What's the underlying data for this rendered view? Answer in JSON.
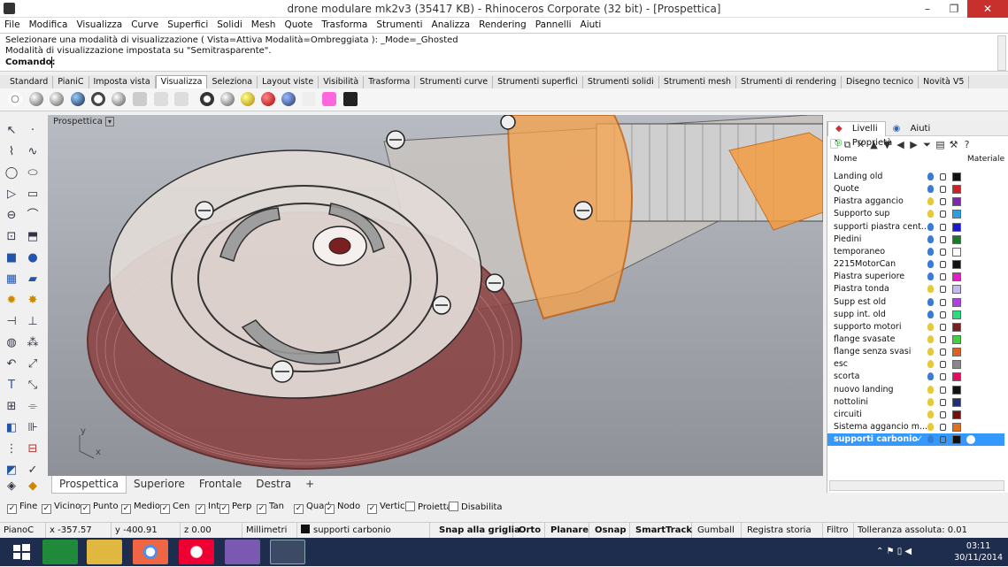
{
  "window": {
    "title": "drone modulare mk2v3 (35417 KB) - Rhinoceros Corporate (32 bit) - [Prospettica]"
  },
  "menu": [
    "File",
    "Modifica",
    "Visualizza",
    "Curve",
    "Superfici",
    "Solidi",
    "Mesh",
    "Quote",
    "Trasforma",
    "Strumenti",
    "Analizza",
    "Rendering",
    "Pannelli",
    "Aiuti"
  ],
  "command": {
    "history1": "Selezionare una modalità di visualizzazione ( Vista=Attiva  Modalità=Ombreggiata ): _Mode=_Ghosted",
    "history2": "Modalità di visualizzazione impostata su \"Semitrasparente\".",
    "prompt": "Comando:"
  },
  "toolbar_tabs": [
    "Standard",
    "PianiC",
    "Imposta vista",
    "Visualizza",
    "Seleziona",
    "Layout viste",
    "Visibilità",
    "Trasforma",
    "Strumenti curve",
    "Strumenti superfici",
    "Strumenti solidi",
    "Strumenti mesh",
    "Strumenti di rendering",
    "Disegno tecnico",
    "Novità V5"
  ],
  "active_toolbar_tab": "Visualizza",
  "viewport": {
    "label": "Prospettica",
    "axis_y": "y",
    "axis_x": "x"
  },
  "view_tabs": [
    "Prospettica",
    "Superiore",
    "Frontale",
    "Destra",
    "+"
  ],
  "panel": {
    "tabs": [
      "Livelli",
      "Aiuti",
      "Proprietà"
    ],
    "col_name": "Nome",
    "col_material": "Materiale",
    "layers": [
      {
        "name": "Landing old",
        "bulb": "#3a7bd5",
        "color": "#111111"
      },
      {
        "name": "Quote",
        "bulb": "#3a7bd5",
        "color": "#cc2222"
      },
      {
        "name": "Piastra aggancio",
        "bulb": "#e8c83a",
        "color": "#7b2aa8"
      },
      {
        "name": "Supporto sup",
        "bulb": "#e8c83a",
        "color": "#2aa0dd"
      },
      {
        "name": "supporti piastra cent...",
        "bulb": "#3a7bd5",
        "color": "#1a1acc"
      },
      {
        "name": "Piedini",
        "bulb": "#3a7bd5",
        "color": "#1a7a2a"
      },
      {
        "name": "temporaneo",
        "bulb": "#3a7bd5",
        "color": "#ffffff"
      },
      {
        "name": "2215MotorCan",
        "bulb": "#3a7bd5",
        "color": "#111111"
      },
      {
        "name": "Piastra superiore",
        "bulb": "#3a7bd5",
        "color": "#e020c0"
      },
      {
        "name": "Piastra tonda",
        "bulb": "#e8c83a",
        "color": "#c8b8f0"
      },
      {
        "name": "Supp est old",
        "bulb": "#3a7bd5",
        "color": "#b040e0"
      },
      {
        "name": "supp int. old",
        "bulb": "#3a7bd5",
        "color": "#20e080"
      },
      {
        "name": "supporto motori",
        "bulb": "#e8c83a",
        "color": "#7a2020"
      },
      {
        "name": "flange svasate",
        "bulb": "#e8c83a",
        "color": "#40d040"
      },
      {
        "name": "flange senza svasi",
        "bulb": "#e8c83a",
        "color": "#e06020"
      },
      {
        "name": "esc",
        "bulb": "#e8c83a",
        "color": "#888888"
      },
      {
        "name": "scorta",
        "bulb": "#3a7bd5",
        "color": "#e01060"
      },
      {
        "name": "nuovo landing",
        "bulb": "#e8c83a",
        "color": "#111111"
      },
      {
        "name": "nottolini",
        "bulb": "#e8c83a",
        "color": "#203070"
      },
      {
        "name": "circuiti",
        "bulb": "#e8c83a",
        "color": "#701010"
      },
      {
        "name": "Sistema aggancio m...",
        "bulb": "#e8c83a",
        "color": "#e07020"
      },
      {
        "name": "supporti carbonio",
        "bulb": "#3a7bd5",
        "color": "#111111",
        "selected": true,
        "check": "✓"
      }
    ]
  },
  "osnaps": [
    {
      "label": "Fine",
      "on": true
    },
    {
      "label": "Vicino",
      "on": true
    },
    {
      "label": "Punto",
      "on": true
    },
    {
      "label": "Medio",
      "on": true
    },
    {
      "label": "Cen",
      "on": true
    },
    {
      "label": "Int",
      "on": true
    },
    {
      "label": "Perp",
      "on": true
    },
    {
      "label": "Tan",
      "on": true
    },
    {
      "label": "Quad",
      "on": true
    },
    {
      "label": "Nodo",
      "on": true
    },
    {
      "label": "Vertice",
      "on": true
    },
    {
      "label": "Proietta",
      "on": false
    },
    {
      "label": "Disabilita",
      "on": false
    }
  ],
  "status": {
    "plane": "PianoC",
    "x": "x -357.57",
    "y": "y -400.91",
    "z": "z 0.00",
    "units": "Millimetri",
    "layer": "supporti carbonio",
    "buttons": [
      "Snap alla griglia",
      "Orto",
      "Planare",
      "Osnap",
      "SmartTrack",
      "Gumball",
      "Registra storia",
      "Filtro"
    ],
    "tolerance": "Tolleranza assoluta: 0.01"
  },
  "taskbar": {
    "time": "03:11",
    "date": "30/11/2014"
  }
}
